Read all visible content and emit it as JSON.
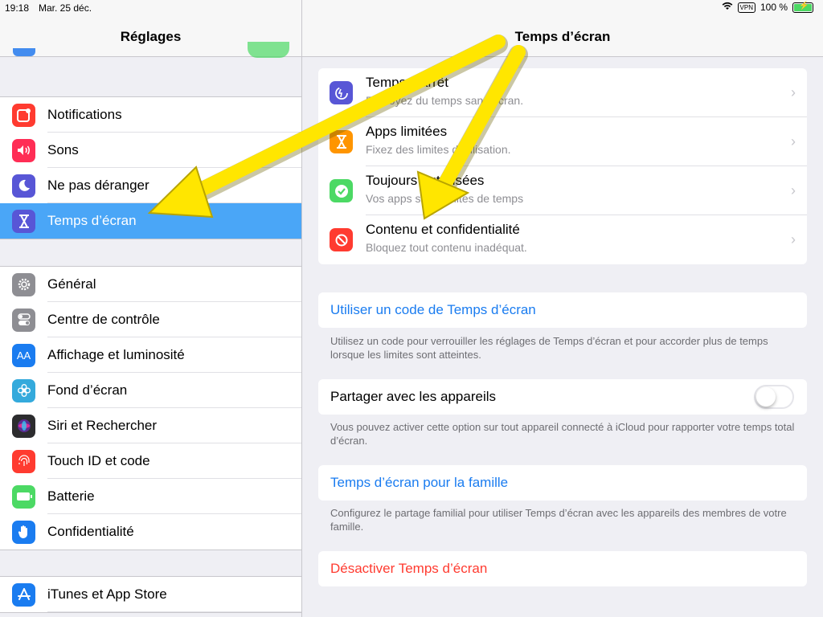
{
  "status_bar": {
    "time": "19:18",
    "date": "Mar. 25 déc.",
    "vpn": "VPN",
    "battery": "100 %"
  },
  "left": {
    "title": "Réglages",
    "groups": [
      [
        {
          "label": "Notifications",
          "icon": "bell-icon",
          "color": "#ff3b30"
        },
        {
          "label": "Sons",
          "icon": "speaker-icon",
          "color": "#ff2d55"
        },
        {
          "label": "Ne pas déranger",
          "icon": "moon-icon",
          "color": "#5856d6"
        },
        {
          "label": "Temps d’écran",
          "icon": "hourglass-icon",
          "color": "#5856d6",
          "selected": true
        }
      ],
      [
        {
          "label": "Général",
          "icon": "gear-icon",
          "color": "#8e8e93"
        },
        {
          "label": "Centre de contrôle",
          "icon": "toggles-icon",
          "color": "#8e8e93"
        },
        {
          "label": "Affichage et luminosité",
          "icon": "text-size-icon",
          "color": "#1a7cf0"
        },
        {
          "label": "Fond d’écran",
          "icon": "flower-icon",
          "color": "#34aadc"
        },
        {
          "label": "Siri et Rechercher",
          "icon": "siri-icon",
          "color": "#2c2c2e"
        },
        {
          "label": "Touch ID et code",
          "icon": "fingerprint-icon",
          "color": "#ff3b30"
        },
        {
          "label": "Batterie",
          "icon": "battery-icon",
          "color": "#4cd964"
        },
        {
          "label": "Confidentialité",
          "icon": "hand-icon",
          "color": "#1a7cf0"
        }
      ],
      [
        {
          "label": "iTunes et App Store",
          "icon": "app-store-icon",
          "color": "#1a7cf0"
        }
      ]
    ]
  },
  "right": {
    "title": "Temps d’écran",
    "items": [
      {
        "title": "Temps d’arrêt",
        "subtitle": "Prévoyez du temps sans écran.",
        "icon": "downtime-icon",
        "color": "#5856d6"
      },
      {
        "title": "Apps limitées",
        "subtitle": "Fixez des limites d’utilisation.",
        "icon": "hourglass-icon",
        "color": "#ff9500"
      },
      {
        "title": "Toujours autorisées",
        "subtitle": "Vos apps sans limites de temps",
        "icon": "checkmark-badge-icon",
        "color": "#4cd964"
      },
      {
        "title": "Contenu et confidentialité",
        "subtitle": "Bloquez tout contenu inadéquat.",
        "icon": "no-entry-icon",
        "color": "#ff3b30"
      }
    ],
    "passcode": {
      "label": "Utiliser un code de Temps d’écran",
      "footer": "Utilisez un code pour verrouiller les réglages de Temps d’écran et pour accorder plus de temps lorsque les limites sont atteintes."
    },
    "share": {
      "label": "Partager avec les appareils",
      "enabled": false,
      "footer": "Vous pouvez activer cette option sur tout appareil connecté à iCloud pour rapporter votre temps total d’écran."
    },
    "family": {
      "label": "Temps d’écran pour la famille",
      "footer": "Configurez le partage familial pour utiliser Temps d’écran avec les appareils des membres de votre famille."
    },
    "disable": {
      "label": "Désactiver Temps d’écran"
    }
  },
  "colors": {
    "accent": "#1a7cf0",
    "selected_row": "#4aa6f7",
    "destructive": "#ff3b30",
    "arrow": "#ffe600"
  }
}
